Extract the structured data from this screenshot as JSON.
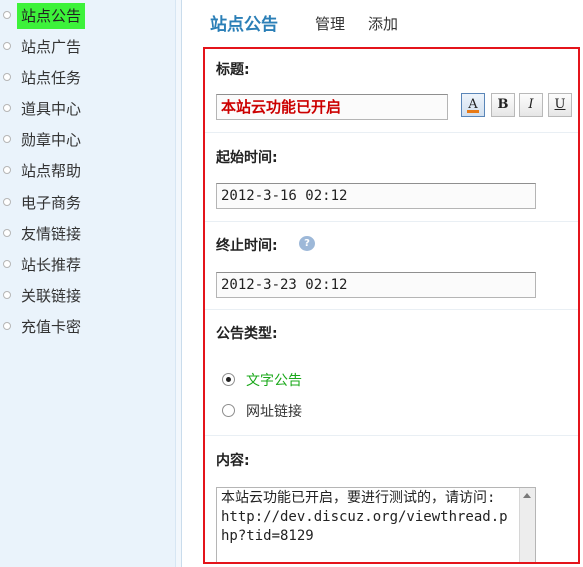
{
  "sidebar": {
    "items": [
      {
        "label": "站点公告",
        "active": true
      },
      {
        "label": "站点广告"
      },
      {
        "label": "站点任务"
      },
      {
        "label": "道具中心"
      },
      {
        "label": "勋章中心"
      },
      {
        "label": "站点帮助"
      },
      {
        "label": "电子商务"
      },
      {
        "label": "友情链接"
      },
      {
        "label": "站长推荐"
      },
      {
        "label": "关联链接"
      },
      {
        "label": "充值卡密"
      }
    ]
  },
  "header": {
    "title": "站点公告",
    "links": [
      "管理",
      "添加"
    ]
  },
  "form": {
    "title_label": "标题:",
    "title_value": "本站云功能已开启",
    "format_buttons": {
      "color": "A",
      "bold": "B",
      "italic": "I",
      "underline": "U"
    },
    "start_label": "起始时间:",
    "start_value": "2012-3-16 02:12",
    "end_label": "终止时间:",
    "end_value": "2012-3-23 02:12",
    "type_label": "公告类型:",
    "type_options": [
      "文字公告",
      "网址链接"
    ],
    "type_selected": "文字公告",
    "content_label": "内容:",
    "content_value": "本站云功能已开启，要进行测试的，请访问:\nhttp://dev.discuz.org/viewthread.php?tid=8129"
  },
  "colors": {
    "active_nav": "#3df23a",
    "header_title": "#2b7fb7",
    "panel_border": "#e4141b",
    "title_text": "#cc0000",
    "selected_option": "#1aa81a"
  }
}
